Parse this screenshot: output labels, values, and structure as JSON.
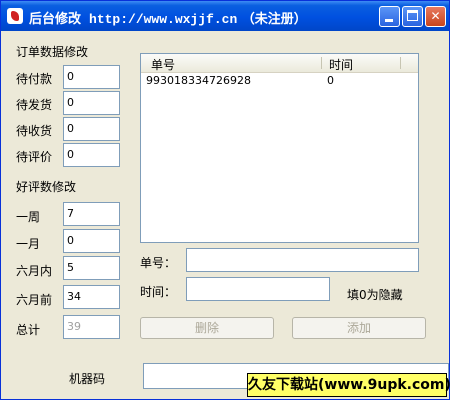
{
  "window": {
    "title": "后台修改",
    "url": "http://www.wxjjf.cn",
    "status": "（未注册）"
  },
  "orders": {
    "section_label": "订单数据修改",
    "fields": [
      {
        "label": "待付款",
        "value": "0"
      },
      {
        "label": "待发货",
        "value": "0"
      },
      {
        "label": "待收货",
        "value": "0"
      },
      {
        "label": "待评价",
        "value": "0"
      }
    ]
  },
  "reviews": {
    "section_label": "好评数修改",
    "fields": [
      {
        "label": "一周",
        "value": "7"
      },
      {
        "label": "一月",
        "value": "0"
      },
      {
        "label": "六月内",
        "value": "5"
      },
      {
        "label": "六月前",
        "value": "34"
      }
    ],
    "total_label": "总计",
    "total_value": "39"
  },
  "list": {
    "columns": [
      "单号",
      "时间"
    ],
    "rows": [
      {
        "order_no": "993018334726928",
        "time": "0"
      }
    ]
  },
  "form": {
    "order_no_label": "单号：",
    "order_no_value": "",
    "time_label": "时间：",
    "time_value": "",
    "hint": "填0为隐藏",
    "delete_label": "删除",
    "add_label": "添加"
  },
  "machine": {
    "label": "机器码",
    "value": ""
  },
  "watermark": "久友下载站(www.9upk.com)"
}
